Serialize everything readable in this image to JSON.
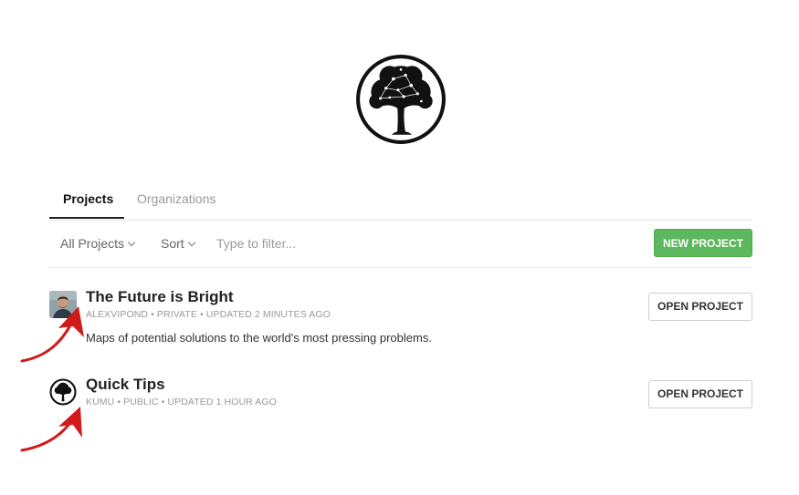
{
  "logo": {
    "icon": "tree-logo-icon",
    "color": "#111111"
  },
  "tabs": [
    {
      "label": "Projects",
      "active": true
    },
    {
      "label": "Organizations",
      "active": false
    }
  ],
  "toolbar": {
    "all_projects_label": "All Projects",
    "sort_label": "Sort",
    "filter_placeholder": "Type to filter...",
    "new_project_label": "NEW PROJECT",
    "new_project_color": "#5cb85c"
  },
  "projects": [
    {
      "title": "The Future is Bright",
      "meta": "ALEXVIPOND • PRIVATE • UPDATED 2 MINUTES AGO",
      "description": "Maps of potential solutions to the world's most pressing problems.",
      "open_label": "OPEN PROJECT",
      "avatar": "user-photo-avatar"
    },
    {
      "title": "Quick Tips",
      "meta": "KUMU • PUBLIC • UPDATED 1 HOUR AGO",
      "open_label": "OPEN PROJECT",
      "avatar": "kumu-tree-avatar"
    }
  ],
  "annotation": {
    "icon": "red-arrow-icon",
    "color": "#d11a1a"
  }
}
